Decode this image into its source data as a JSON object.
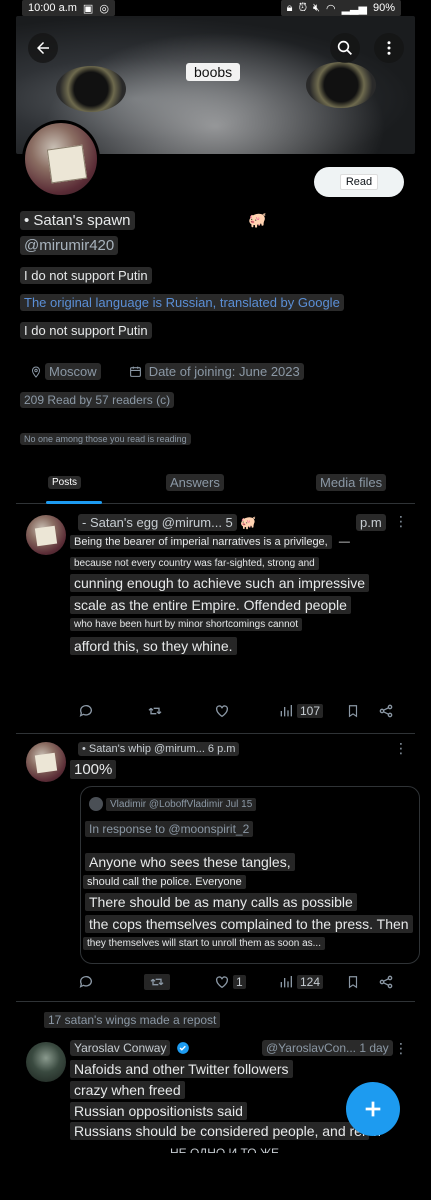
{
  "status_bar": {
    "time": "10:00 a.m",
    "battery": "90%"
  },
  "banner": {
    "label": "boobs"
  },
  "profile": {
    "name": "• Satan's spawn",
    "handle": "@mirumir420",
    "read_button": "Read",
    "bio_line_1": "I do not support Putin",
    "translated_note": "The original language is Russian, translated by Google",
    "bio_line_2": "I do not support Putin",
    "location": "Moscow",
    "joined": "Date of joining: June 2023",
    "readers": "209 Read by 57 readers (c)",
    "none_reading": "No one among those you read is reading"
  },
  "tabs": {
    "posts": "Posts",
    "answers": "Answers",
    "media": "Media files"
  },
  "tweets": [
    {
      "header": "- Satan's egg @mirum... 5",
      "time": "p.m",
      "lines": [
        "Being the bearer of imperial narratives is a privilege,",
        "because not every country was far-sighted, strong and",
        "cunning enough to achieve such an impressive",
        "scale as the entire Empire. Offended people",
        "who have been hurt by minor shortcomings cannot",
        "afford this, so they whine."
      ],
      "views": "107"
    },
    {
      "header": "• Satan's whip @mirum... 6 p.m",
      "text": "100%",
      "quote": {
        "author": "Vladimir @LoboffVladimir Jul 15",
        "reply_to": "In response to @moonspirit_2",
        "lines": [
          "Anyone who sees these tangles,",
          "should call the police. Everyone",
          "There should be as many calls as possible",
          "the cops themselves complained to the press. Then",
          "they themselves will start to unroll them as soon as..."
        ]
      },
      "likes": "1",
      "views": "124"
    },
    {
      "repost_note": "17 satan's wings made a repost",
      "author": "Yaroslav Conway",
      "handle_time": "@YaroslavCon... 1 day",
      "lines": [
        "Nafoids and other Twitter followers",
        "crazy when freed",
        "Russian oppositionists said",
        "Russians should be considered people, and rel"
      ],
      "cut_text": "НЕ ОДНО И ТО ЖЕ"
    }
  ]
}
